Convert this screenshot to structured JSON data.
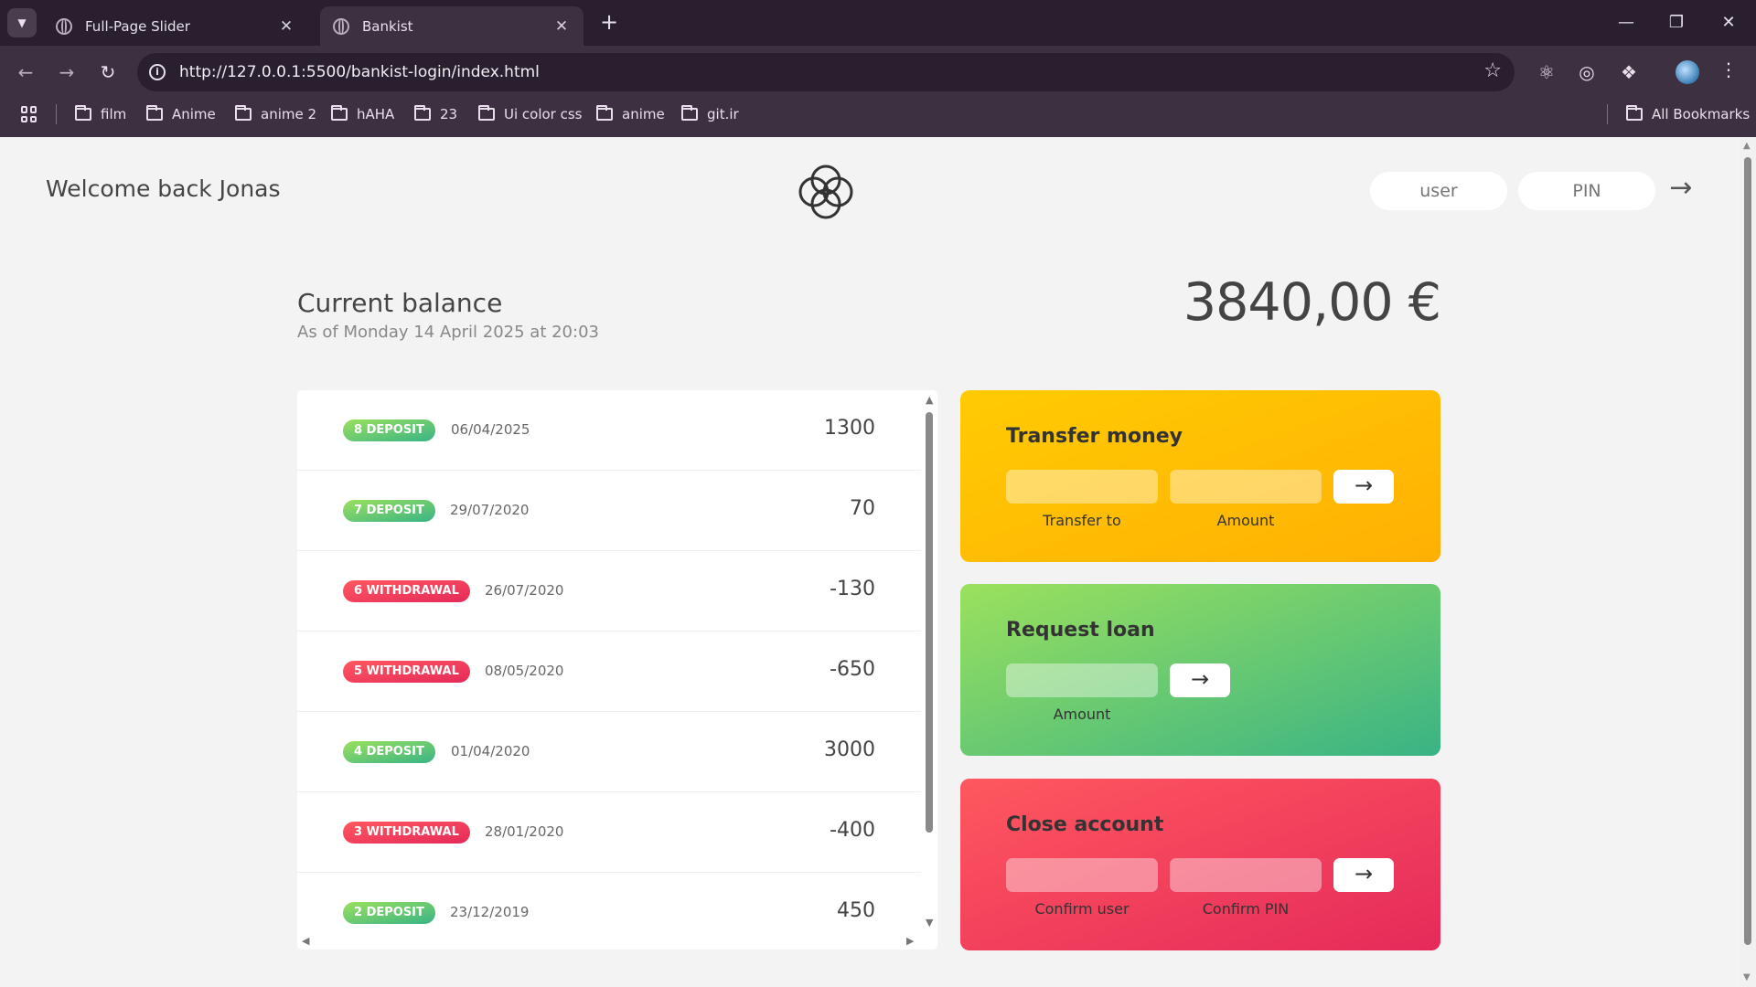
{
  "browser": {
    "tabs": [
      {
        "title": "Full-Page Slider",
        "active": false
      },
      {
        "title": "Bankist",
        "active": true
      }
    ],
    "url": "http://127.0.0.1:5500/bankist-login/index.html",
    "bookmarks": [
      "film",
      "Anime",
      "anime 2",
      "hAHA",
      "23",
      "Ui color css",
      "anime",
      "git.ir"
    ],
    "all_bookmarks": "All Bookmarks",
    "new_tab": "+",
    "tab_close": "✕",
    "min": "—",
    "restore": "❐",
    "close": "✕"
  },
  "app": {
    "welcome": "Welcome back Jonas",
    "login": {
      "user_placeholder": "user",
      "pin_placeholder": "PIN",
      "button": "→"
    },
    "balance": {
      "label": "Current balance",
      "date_prefix": "As of ",
      "date": "Monday 14 April 2025 at 20:03",
      "value": "3840,00 €"
    },
    "movements": [
      {
        "type_label": "8 DEPOSIT",
        "kind": "deposit",
        "date": "06/04/2025",
        "value": "1300"
      },
      {
        "type_label": "7 DEPOSIT",
        "kind": "deposit",
        "date": "29/07/2020",
        "value": "70"
      },
      {
        "type_label": "6 WITHDRAWAL",
        "kind": "withdrawal",
        "date": "26/07/2020",
        "value": "-130"
      },
      {
        "type_label": "5 WITHDRAWAL",
        "kind": "withdrawal",
        "date": "08/05/2020",
        "value": "-650"
      },
      {
        "type_label": "4 DEPOSIT",
        "kind": "deposit",
        "date": "01/04/2020",
        "value": "3000"
      },
      {
        "type_label": "3 WITHDRAWAL",
        "kind": "withdrawal",
        "date": "28/01/2020",
        "value": "-400"
      },
      {
        "type_label": "2 DEPOSIT",
        "kind": "deposit",
        "date": "23/12/2019",
        "value": "450"
      }
    ],
    "transfer": {
      "title": "Transfer money",
      "label_to": "Transfer to",
      "label_amount": "Amount",
      "button": "→"
    },
    "loan": {
      "title": "Request loan",
      "label_amount": "Amount",
      "button": "→"
    },
    "close": {
      "title": "Close account",
      "label_user": "Confirm user",
      "label_pin": "Confirm PIN",
      "button": "→"
    }
  },
  "colors": {
    "deposit": "#39b385",
    "withdrawal": "#e52a5a",
    "transfer": "#ffcb03",
    "loan": "#9be15d",
    "close": "#ff585f"
  }
}
